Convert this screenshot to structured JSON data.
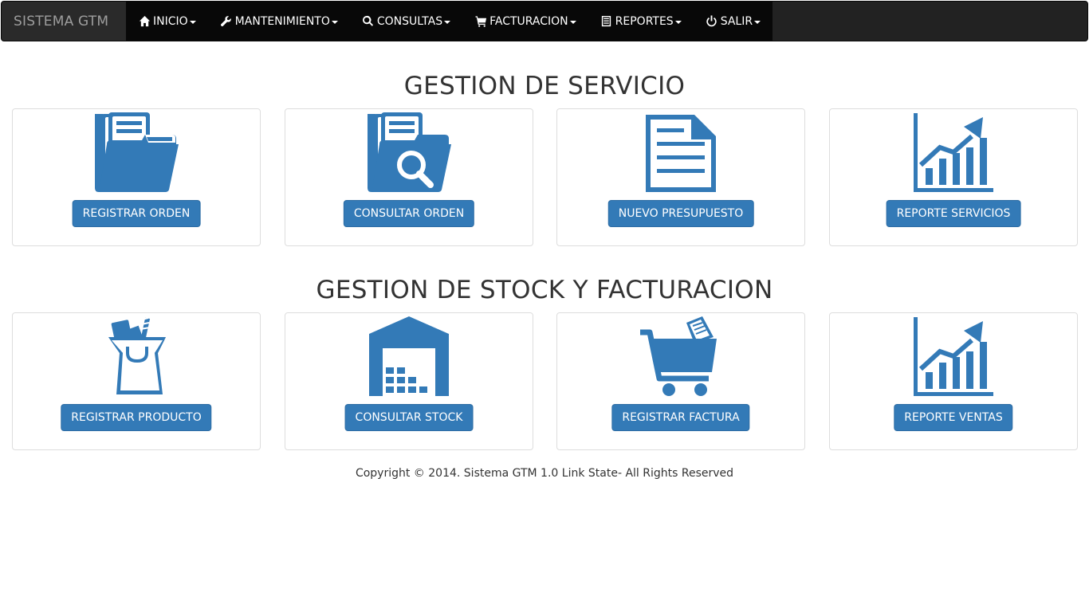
{
  "navbar": {
    "brand": "SISTEMA GTM",
    "items": [
      {
        "label": "INICIO",
        "icon": "home-icon"
      },
      {
        "label": "MANTENIMIENTO",
        "icon": "wrench-icon"
      },
      {
        "label": "CONSULTAS",
        "icon": "search-icon"
      },
      {
        "label": "FACTURACION",
        "icon": "cart-icon"
      },
      {
        "label": "REPORTES",
        "icon": "list-icon"
      },
      {
        "label": "SALIR",
        "icon": "power-icon"
      }
    ]
  },
  "sections": [
    {
      "title": "GESTION DE SERVICIO",
      "cards": [
        {
          "icon": "folder-documents-icon",
          "button": "REGISTRAR ORDEN"
        },
        {
          "icon": "folder-search-icon",
          "button": "CONSULTAR ORDEN"
        },
        {
          "icon": "document-icon",
          "button": "NUEVO PRESUPUESTO"
        },
        {
          "icon": "growth-chart-icon",
          "button": "REPORTE SERVICIOS"
        }
      ]
    },
    {
      "title": "GESTION DE STOCK Y FACTURACION",
      "cards": [
        {
          "icon": "shopping-bag-icon",
          "button": "REGISTRAR PRODUCTO"
        },
        {
          "icon": "warehouse-icon",
          "button": "CONSULTAR STOCK"
        },
        {
          "icon": "shopping-cart-receipt-icon",
          "button": "REGISTRAR FACTURA"
        },
        {
          "icon": "growth-chart-icon",
          "button": "REPORTE VENTAS"
        }
      ]
    }
  ],
  "footer": "Copyright © 2014. Sistema GTM 1.0 Link State- All Rights Reserved",
  "colors": {
    "primary": "#337ab7",
    "navbar": "#222222",
    "navbar_active": "#080808"
  }
}
